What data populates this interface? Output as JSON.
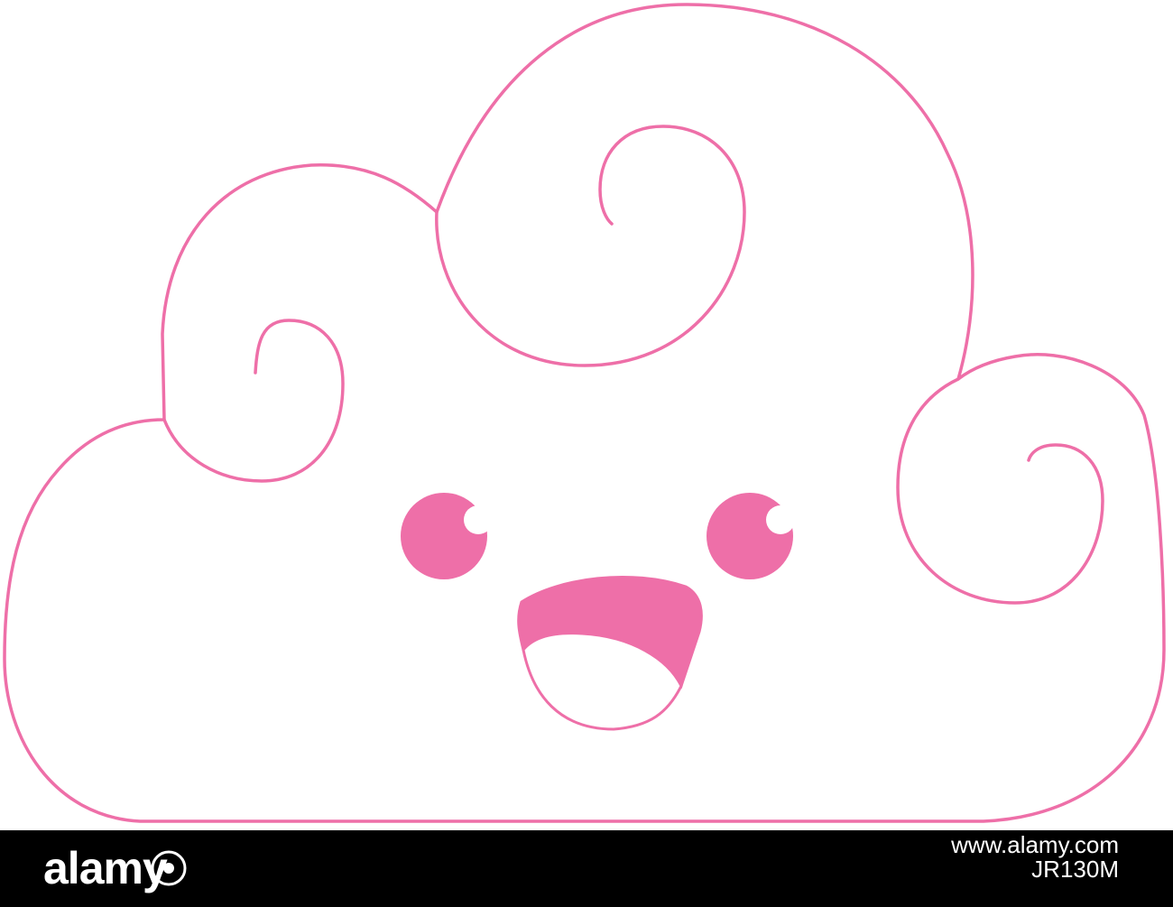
{
  "illustration": {
    "subject": "kawaii-cloud",
    "stroke_color": "#ee6fa8",
    "fill_color": "#ffffff",
    "face_color": "#ee6fa8",
    "eye_highlight_color": "#ffffff"
  },
  "footer": {
    "logo_text": "alamy",
    "image_id": "JR130M",
    "url": "www.alamy.com",
    "background_color": "#000000",
    "text_color": "#ffffff"
  }
}
